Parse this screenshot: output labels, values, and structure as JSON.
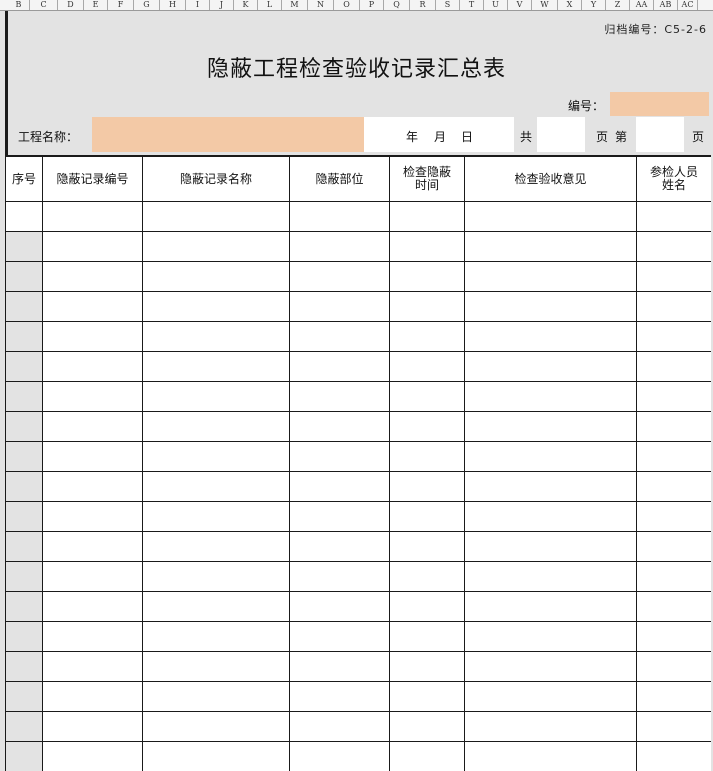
{
  "columns": [
    "B",
    "C",
    "D",
    "E",
    "F",
    "G",
    "H",
    "I",
    "J",
    "K",
    "L",
    "M",
    "N",
    "O",
    "P",
    "Q",
    "R",
    "S",
    "T",
    "U",
    "V",
    "W",
    "X",
    "Y",
    "Z",
    "AA",
    "AB",
    "AC"
  ],
  "archive_no": "归档编号：C5-2-6",
  "title": "隐蔽工程检查验收记录汇总表",
  "serial_label": "编号：",
  "project_label": "工程名称：",
  "date": {
    "year": "年",
    "month": "月",
    "day": "日"
  },
  "total_label": "共",
  "pages_label": "页",
  "page_label": "第",
  "page_suffix": "页",
  "table": {
    "headers": [
      [
        "序号"
      ],
      [
        "隐蔽记录编号"
      ],
      [
        "隐蔽记录名称"
      ],
      [
        "隐蔽部位"
      ],
      [
        "检查隐蔽",
        "时间"
      ],
      [
        "检查验收意见"
      ],
      [
        "参检人员",
        "姓名"
      ]
    ],
    "empty_rows": 19
  },
  "colors": {
    "field_fill": "#f3c9a6",
    "background": "#e3e3e3",
    "grid": "#1a1a1a"
  }
}
